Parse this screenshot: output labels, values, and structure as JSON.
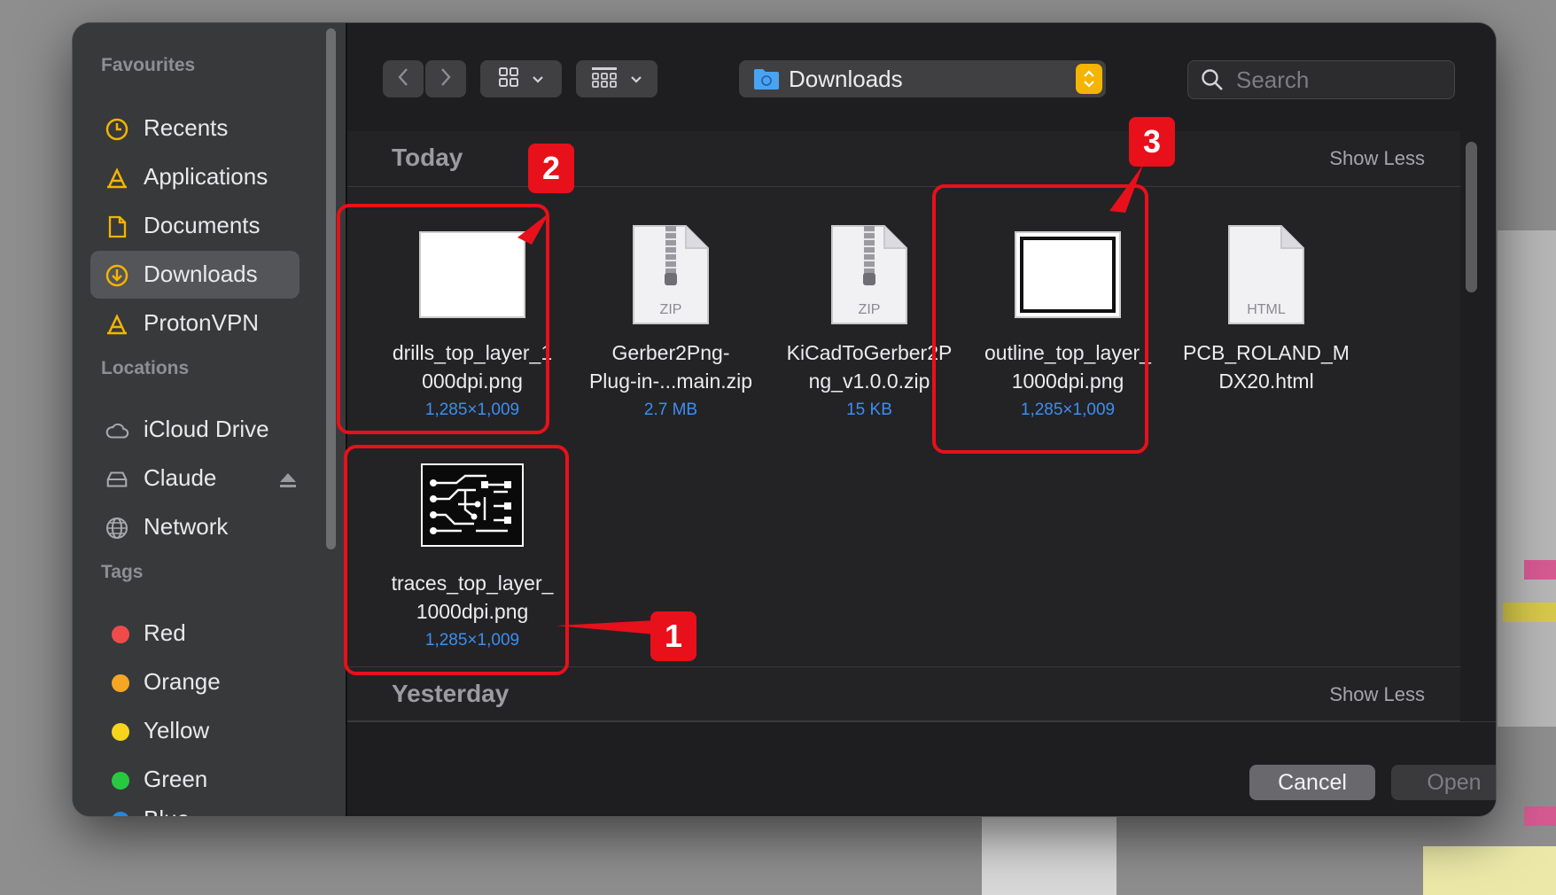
{
  "sidebar": {
    "favourites_header": "Favourites",
    "locations_header": "Locations",
    "tags_header": "Tags",
    "favourites": [
      {
        "label": "Recents",
        "icon": "clock-icon"
      },
      {
        "label": "Applications",
        "icon": "applications-icon"
      },
      {
        "label": "Documents",
        "icon": "document-icon"
      },
      {
        "label": "Downloads",
        "icon": "download-icon",
        "selected": true
      },
      {
        "label": "ProtonVPN",
        "icon": "applications-icon"
      }
    ],
    "locations": [
      {
        "label": "iCloud Drive",
        "icon": "cloud-icon"
      },
      {
        "label": "Claude",
        "icon": "drive-icon",
        "eject": true
      },
      {
        "label": "Network",
        "icon": "globe-icon"
      }
    ],
    "tags": [
      {
        "label": "Red",
        "color": "#ef4b4b"
      },
      {
        "label": "Orange",
        "color": "#f5a623"
      },
      {
        "label": "Yellow",
        "color": "#f7d51d"
      },
      {
        "label": "Green",
        "color": "#28c840"
      },
      {
        "label": "Blue",
        "color": "#1e88e5"
      }
    ]
  },
  "toolbar": {
    "path_label": "Downloads",
    "search_placeholder": "Search"
  },
  "groups": {
    "today": {
      "title": "Today",
      "toggle": "Show Less"
    },
    "yesterday": {
      "title": "Yesterday",
      "toggle": "Show Less"
    }
  },
  "files": [
    {
      "name_line1": "drills_top_layer_1",
      "name_line2": "000dpi.png",
      "meta": "1,285×1,009",
      "kind": "image-white"
    },
    {
      "name_line1": "Gerber2Png-",
      "name_line2": "Plug-in-...main.zip",
      "meta": "2.7 MB",
      "kind": "zip",
      "badge": "ZIP"
    },
    {
      "name_line1": "KiCadToGerber2P",
      "name_line2": "ng_v1.0.0.zip",
      "meta": "15 KB",
      "kind": "zip",
      "badge": "ZIP"
    },
    {
      "name_line1": "outline_top_layer_",
      "name_line2": "1000dpi.png",
      "meta": "1,285×1,009",
      "kind": "image-outline"
    },
    {
      "name_line1": "PCB_ROLAND_M",
      "name_line2": "DX20.html",
      "meta": "",
      "kind": "html",
      "badge": "HTML"
    },
    {
      "name_line1": "traces_top_layer_",
      "name_line2": "1000dpi.png",
      "meta": "1,285×1,009",
      "kind": "image-traces"
    }
  ],
  "footer": {
    "cancel_label": "Cancel",
    "open_label": "Open"
  },
  "annotations": [
    {
      "number": "1"
    },
    {
      "number": "2"
    },
    {
      "number": "3"
    }
  ],
  "colors": {
    "accent": "#3d8ef0",
    "annotation": "#e8101a",
    "path_stepper": "#f4b400"
  }
}
